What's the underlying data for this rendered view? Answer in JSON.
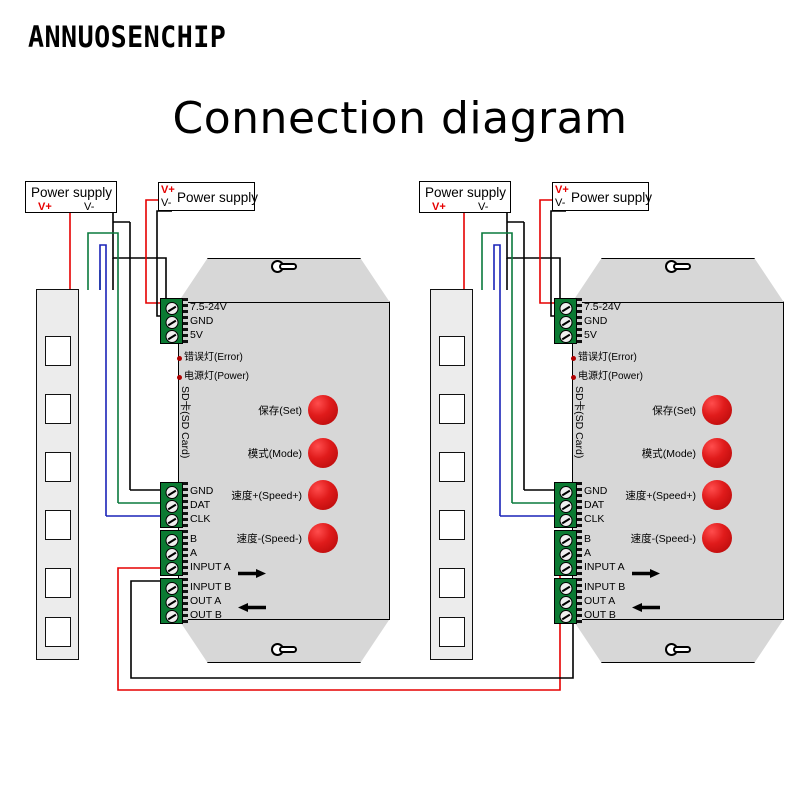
{
  "header": {
    "brand": "ANNUOSENCHIP",
    "title": "Connection diagram"
  },
  "power_supplies": [
    {
      "label": "Power supply",
      "v_plus": "V+",
      "v_minus": "V-",
      "style": "label-top"
    },
    {
      "label": "Power supply",
      "v_plus": "V+",
      "v_minus": "V-",
      "style": "label-right"
    },
    {
      "label": "Power supply",
      "v_plus": "V+",
      "v_minus": "V-",
      "style": "label-top"
    },
    {
      "label": "Power supply",
      "v_plus": "V+",
      "v_minus": "V-",
      "style": "label-right"
    }
  ],
  "controller": {
    "power_terminals": [
      "7.5-24V",
      "GND",
      "5V"
    ],
    "indicators": [
      {
        "label": "错误灯(Error)",
        "color": "#b00000"
      },
      {
        "label": "电源灯(Power)",
        "color": "#b00000"
      }
    ],
    "sd_label": "SD卡(SD Card)",
    "buttons": [
      {
        "label": "保存(Set)"
      },
      {
        "label": "模式(Mode)"
      },
      {
        "label": "速度+(Speed+)"
      },
      {
        "label": "速度-(Speed-)"
      }
    ],
    "signal_terminals_top": [
      "GND",
      "DAT",
      "CLK"
    ],
    "signal_terminals_mid": [
      "B",
      "A",
      "INPUT A"
    ],
    "signal_terminals_bottom": [
      "INPUT B",
      "OUT A",
      "OUT B"
    ],
    "arrows": [
      {
        "name": "input-arrow",
        "direction": "right"
      },
      {
        "name": "output-arrow",
        "direction": "left"
      }
    ]
  },
  "colors": {
    "wire_positive": "#e60000",
    "wire_negative": "#000000",
    "wire_data": "#0a7a3d",
    "wire_clock": "#1a23b8",
    "terminal_green": "#0b7a32",
    "button_red": "#e01b1b",
    "body_gray": "#d7d7d7",
    "strip_gray": "#ececec"
  },
  "led_strips": [
    {
      "name": "led-strip-left",
      "pads": 6
    },
    {
      "name": "led-strip-right",
      "pads": 6
    }
  ]
}
